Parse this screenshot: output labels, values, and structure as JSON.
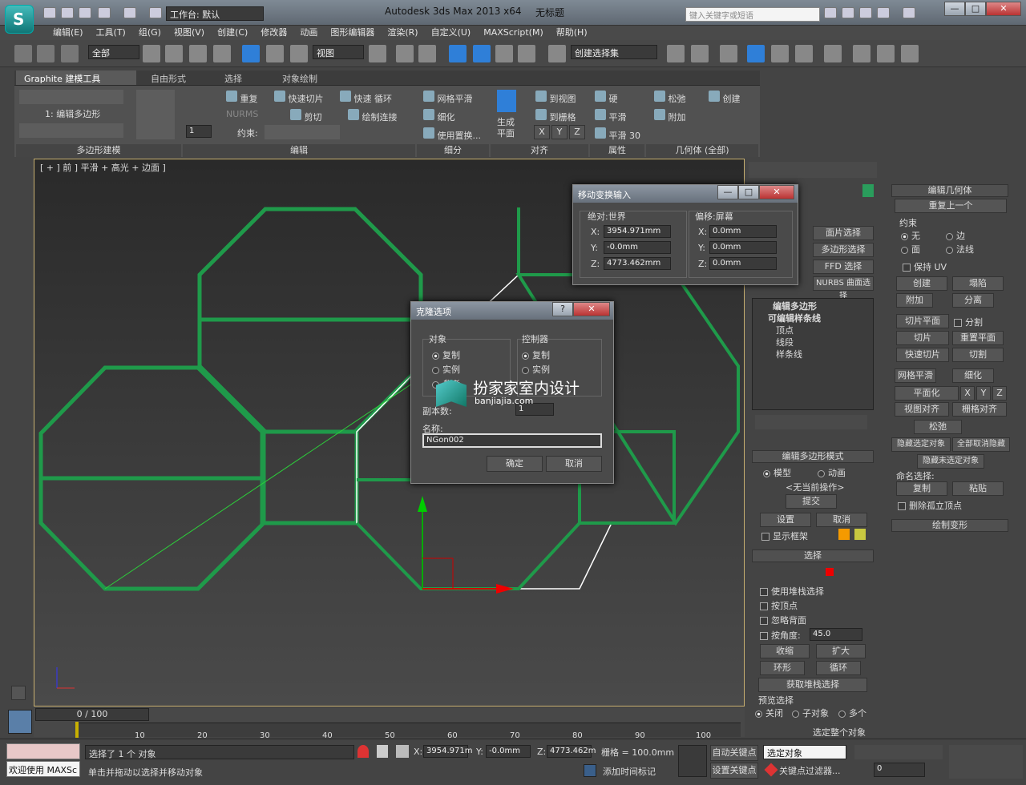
{
  "titlebar": {
    "workspace": "工作台: 默认",
    "app": "Autodesk 3ds Max  2013 x64",
    "doc": "无标题",
    "search_placeholder": "键入关键字或短语",
    "min": "—",
    "max": "□",
    "close": "✕"
  },
  "menu": [
    "编辑(E)",
    "工具(T)",
    "组(G)",
    "视图(V)",
    "创建(C)",
    "修改器",
    "动画",
    "图形编辑器",
    "渲染(R)",
    "自定义(U)",
    "MAXScript(M)",
    "帮助(H)"
  ],
  "toolbar": {
    "filter": "全部",
    "refcoord": "视图",
    "selset": "创建选择集"
  },
  "ribbon": {
    "tabs": [
      "Graphite 建模工具",
      "自由形式",
      "选择",
      "对象绘制"
    ],
    "mode_label": "1: 编辑多边形",
    "spin_value": "1",
    "edit": {
      "repeat": "重复",
      "quickslice": "快速切片",
      "quickloop": "快速 循环",
      "nurms": "NURMS",
      "cut": "剪切",
      "paintconnect": "绘制连接",
      "constraint": "约束:"
    },
    "subdiv": {
      "meshsmooth": "网格平滑",
      "tessellate": "细化",
      "displace": "使用置换..."
    },
    "align": {
      "makeplanar": "生成平面",
      "toview": "到视图",
      "togrid": "到栅格",
      "x": "X",
      "y": "Y",
      "z": "Z"
    },
    "props": {
      "hard": "硬",
      "smooth": "平滑",
      "smooth30": "平滑 30"
    },
    "geom": {
      "relax": "松弛",
      "attach": "附加",
      "create": "创建"
    },
    "groups": [
      "多边形建模",
      "编辑",
      "细分",
      "对齐",
      "属性",
      "几何体 (全部)"
    ]
  },
  "viewport": {
    "label": "[ + ] 前 ] 平滑 + 高光 + 边面 ]"
  },
  "move_dialog": {
    "title": "移动变换输入",
    "abs_label": "绝对:世界",
    "off_label": "偏移:屏幕",
    "abs": {
      "x": "3954.971mm",
      "y": "-0.0mm",
      "z": "4773.462mm"
    },
    "off": {
      "x": "0.0mm",
      "y": "0.0mm",
      "z": "0.0mm"
    },
    "xl": "X:",
    "yl": "Y:",
    "zl": "Z:"
  },
  "clone_dialog": {
    "title": "克隆选项",
    "help": "?",
    "object_label": "对象",
    "controller_label": "控制器",
    "copy": "复制",
    "instance": "实例",
    "reference": "参考",
    "copies_label": "副本数:",
    "copies": "1",
    "name_label": "名称:",
    "name_value": "NGon002",
    "ok": "确定",
    "cancel": "取消"
  },
  "watermark": {
    "cn": "扮家家室内设计",
    "url": "banjiajia.com"
  },
  "cmdpanel": {
    "mod_buttons": [
      "面片选择",
      "多边形选择",
      "FFD 选择",
      "NURBS 曲面选择"
    ],
    "stack": {
      "edit_poly": "编辑多边形",
      "editable_spline": "可编辑样条线",
      "vertex": "顶点",
      "segment": "线段",
      "spline": "样条线"
    },
    "editpoly_mode": {
      "title": "编辑多边形模式",
      "model": "模型",
      "animate": "动画",
      "no_op": "<无当前操作>",
      "commit": "提交",
      "settings": "设置",
      "cancel": "取消",
      "show_cage": "显示框架"
    },
    "selection": {
      "title": "选择",
      "use_stack": "使用堆栈选择",
      "by_vertex": "按顶点",
      "ignore_back": "忽略背面",
      "by_angle": "按角度:",
      "angle": "45.0",
      "shrink": "收缩",
      "grow": "扩大",
      "ring": "环形",
      "loop": "循环",
      "get_stack": "获取堆栈选择",
      "preview": "预览选择",
      "off": "关闭",
      "subobj": "子对象",
      "multi": "多个",
      "select_all": "选定整个对象"
    },
    "editgeo": {
      "title": "编辑几何体",
      "repeat_last": "重复上一个",
      "constraint": "约束",
      "none": "无",
      "edge": "边",
      "face": "面",
      "normal": "法线",
      "preserve_uv": "保持 UV",
      "create": "创建",
      "collapse": "塌陷",
      "attach": "附加",
      "detach": "分离",
      "sliceplane": "切片平面",
      "split": "分割",
      "slice": "切片",
      "resetplane": "重置平面",
      "quickslice": "快速切片",
      "cut": "切割",
      "meshsmooth": "网格平滑",
      "tessellate": "细化",
      "makeplanar": "平面化",
      "x": "X",
      "y": "Y",
      "z": "Z",
      "viewalign": "视图对齐",
      "gridalign": "栅格对齐",
      "relax": "松弛",
      "hide_sel": "隐藏选定对象",
      "unhide_all": "全部取消隐藏",
      "hide_unsel": "隐藏未选定对象",
      "named_sel": "命名选择:",
      "copy": "复制",
      "paste": "粘贴",
      "del_iso": "删除孤立顶点"
    },
    "paint": "绘制变形"
  },
  "timeline": {
    "counter": "0 / 100",
    "ticks": [
      "10",
      "20",
      "30",
      "40",
      "50",
      "60",
      "70",
      "80",
      "90",
      "100"
    ]
  },
  "status": {
    "welcome": "欢迎使用 MAXSc",
    "selected": "选择了 1 个 对象",
    "hint": "单击并拖动以选择并移动对象",
    "x": "3954.971m",
    "y": "-0.0mm",
    "z": "4773.462m",
    "grid": "栅格 = 100.0mm",
    "addtime": "添加时间标记",
    "autokey": "自动关键点",
    "setkey": "设置关键点",
    "selmode": "选定对象",
    "keyfilter": "关键点过滤器...",
    "frame": "0"
  },
  "colors": {
    "accent": "#2a9d5c",
    "wire": "#1f9a4a",
    "selected": "#ffffff"
  }
}
